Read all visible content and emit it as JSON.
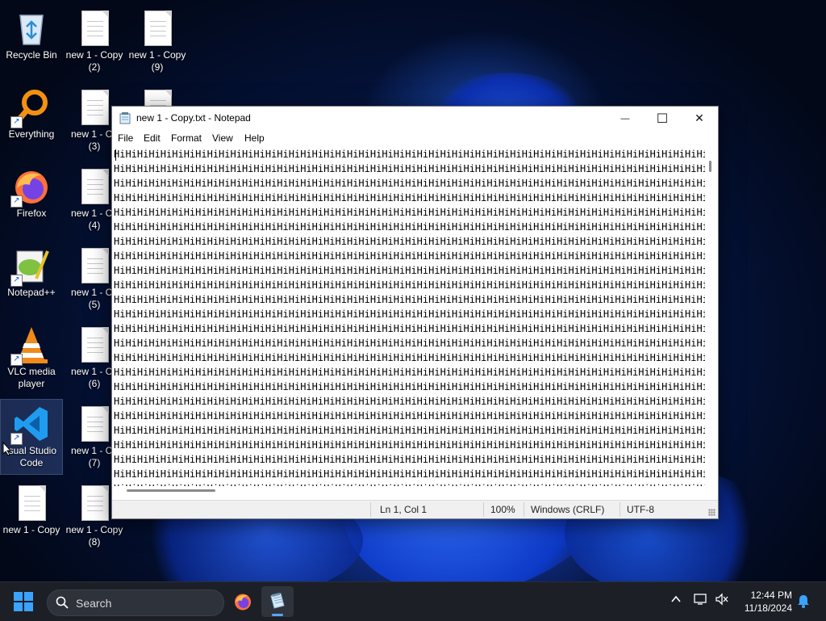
{
  "desktop": {
    "icons": [
      {
        "label": "Recycle Bin",
        "kind": "recycle-bin-icon"
      },
      {
        "label": "new 1 - Copy\n(2)",
        "kind": "text-file-icon"
      },
      {
        "label": "new 1 - Copy\n(9)",
        "kind": "text-file-icon"
      },
      {
        "label": "Everything",
        "kind": "everything-search-icon"
      },
      {
        "label": "new 1 - Co\n(3)",
        "kind": "text-file-icon"
      },
      {
        "label": "Firefox",
        "kind": "firefox-icon"
      },
      {
        "label": "new 1 - Co\n(4)",
        "kind": "text-file-icon"
      },
      {
        "label": "Notepad++",
        "kind": "notepad-plus-plus-icon"
      },
      {
        "label": "new 1 - Co\n(5)",
        "kind": "text-file-icon"
      },
      {
        "label": "VLC media\nplayer",
        "kind": "vlc-icon"
      },
      {
        "label": "new 1 - Co\n(6)",
        "kind": "text-file-icon"
      },
      {
        "label": "isual Studio\nCode",
        "kind": "vscode-icon"
      },
      {
        "label": "new 1 - Co\n(7)",
        "kind": "text-file-icon"
      },
      {
        "label": "new 1 - Copy",
        "kind": "text-file-icon"
      },
      {
        "label": "new 1 - Copy\n(8)",
        "kind": "text-file-icon"
      }
    ]
  },
  "notepad": {
    "title": "new 1 - Copy.txt - Notepad",
    "controls": {
      "minimize": "—",
      "maximize": "☐",
      "close": "✕"
    },
    "menu": [
      "File",
      "Edit",
      "Format",
      "View",
      "Help"
    ],
    "text_line": "HiHiHiHiHiHiHiHiHiHiHiHiHiHiHiHiHiHiHiHiHiHiHiHiHiHiHiHiHiHiHiHiHiHiHiHiHiHiHiHiHiHiHiHiHiHiHiHiHiHiHiHiHiHiHiHiHiHiHiHiHiH",
    "status": {
      "position": "Ln 1, Col 1",
      "zoom": "100%",
      "line_endings": "Windows (CRLF)",
      "encoding": "UTF-8"
    }
  },
  "taskbar": {
    "search_placeholder": "Search",
    "clock_time": "12:44 PM",
    "clock_date": "11/18/2024",
    "pinned": [
      "firefox-icon",
      "notepad-icon"
    ]
  },
  "colors": {
    "accent": "#3aa3ff",
    "taskbar_bg": "#1c1f26",
    "statusbar_bg": "#f0f0f0"
  }
}
